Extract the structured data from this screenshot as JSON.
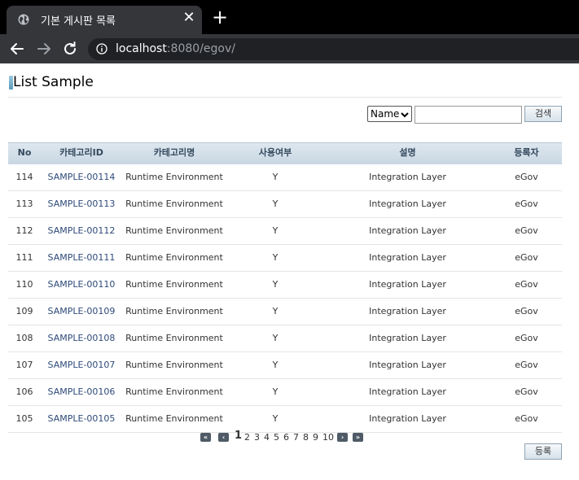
{
  "browser": {
    "tab_title": "기본 게시판 목록",
    "tab_close": "✕",
    "new_tab": "+",
    "url_host": "localhost",
    "url_rest": ":8080/egov/"
  },
  "page": {
    "title": "List Sample",
    "search": {
      "select_value": "Name",
      "input_value": "",
      "button_label": "검색"
    },
    "register_button_label": "등록"
  },
  "table": {
    "headers": [
      "No",
      "카테고리ID",
      "카테고리명",
      "사용여부",
      "설명",
      "등록자"
    ],
    "rows": [
      {
        "no": "114",
        "id": "SAMPLE-00114",
        "name": "Runtime Environment",
        "use": "Y",
        "desc": "Integration Layer",
        "reg": "eGov"
      },
      {
        "no": "113",
        "id": "SAMPLE-00113",
        "name": "Runtime Environment",
        "use": "Y",
        "desc": "Integration Layer",
        "reg": "eGov"
      },
      {
        "no": "112",
        "id": "SAMPLE-00112",
        "name": "Runtime Environment",
        "use": "Y",
        "desc": "Integration Layer",
        "reg": "eGov"
      },
      {
        "no": "111",
        "id": "SAMPLE-00111",
        "name": "Runtime Environment",
        "use": "Y",
        "desc": "Integration Layer",
        "reg": "eGov"
      },
      {
        "no": "110",
        "id": "SAMPLE-00110",
        "name": "Runtime Environment",
        "use": "Y",
        "desc": "Integration Layer",
        "reg": "eGov"
      },
      {
        "no": "109",
        "id": "SAMPLE-00109",
        "name": "Runtime Environment",
        "use": "Y",
        "desc": "Integration Layer",
        "reg": "eGov"
      },
      {
        "no": "108",
        "id": "SAMPLE-00108",
        "name": "Runtime Environment",
        "use": "Y",
        "desc": "Integration Layer",
        "reg": "eGov"
      },
      {
        "no": "107",
        "id": "SAMPLE-00107",
        "name": "Runtime Environment",
        "use": "Y",
        "desc": "Integration Layer",
        "reg": "eGov"
      },
      {
        "no": "106",
        "id": "SAMPLE-00106",
        "name": "Runtime Environment",
        "use": "Y",
        "desc": "Integration Layer",
        "reg": "eGov"
      },
      {
        "no": "105",
        "id": "SAMPLE-00105",
        "name": "Runtime Environment",
        "use": "Y",
        "desc": "Integration Layer",
        "reg": "eGov"
      }
    ]
  },
  "pagination": {
    "first_icon": "«",
    "prev_icon": "‹",
    "next_icon": "›",
    "last_icon": "»",
    "pages": [
      "1",
      "2",
      "3",
      "4",
      "5",
      "6",
      "7",
      "8",
      "9",
      "10"
    ],
    "current": "1"
  }
}
